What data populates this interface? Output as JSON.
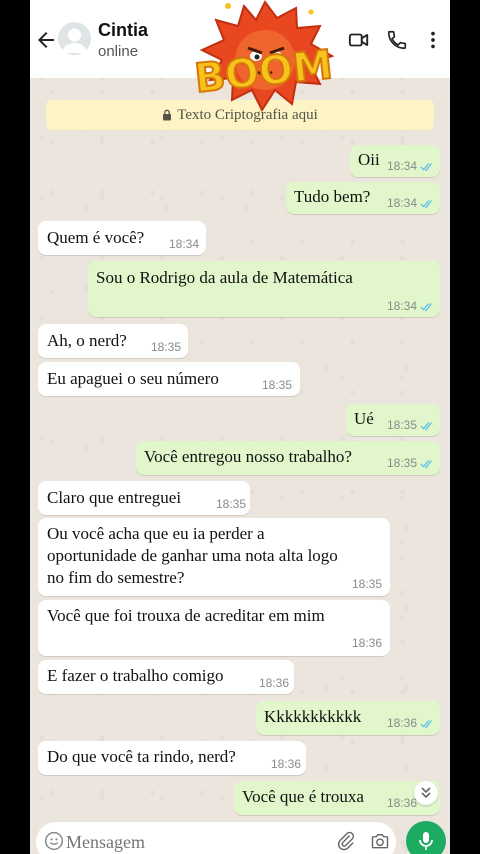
{
  "header": {
    "contact_name": "Cintia",
    "status": "online"
  },
  "sticker": {
    "text": "BOOM"
  },
  "banner": {
    "text": "Texto Criptografia aqui"
  },
  "messages": [
    {
      "dir": "out",
      "text": "Oii",
      "time": "18:34"
    },
    {
      "dir": "out",
      "text": "Tudo bem?",
      "time": "18:34"
    },
    {
      "dir": "in",
      "text": "Quem é você?",
      "time": "18:34"
    },
    {
      "dir": "out",
      "text": "Sou o Rodrigo da aula de Matemática",
      "time": "18:34"
    },
    {
      "dir": "in",
      "text": "Ah, o nerd?",
      "time": "18:35"
    },
    {
      "dir": "in",
      "text": "Eu apaguei o seu número",
      "time": "18:35"
    },
    {
      "dir": "out",
      "text": "Ué",
      "time": "18:35"
    },
    {
      "dir": "out",
      "text": "Você entregou nosso trabalho?",
      "time": "18:35"
    },
    {
      "dir": "in",
      "text": "Claro que entreguei",
      "time": "18:35"
    },
    {
      "dir": "in",
      "text": "Ou você acha que eu ia perder a\noportunidade de ganhar uma nota alta logo\nno fim do semestre?",
      "time": "18:35"
    },
    {
      "dir": "in",
      "text": "Você que foi trouxa de acreditar em mim",
      "time": "18:36"
    },
    {
      "dir": "in",
      "text": "E fazer o trabalho comigo",
      "time": "18:36"
    },
    {
      "dir": "out",
      "text": "Kkkkkkkkkkk",
      "time": "18:36"
    },
    {
      "dir": "in",
      "text": "Do que você ta rindo, nerd?",
      "time": "18:36"
    },
    {
      "dir": "out",
      "text": "Você que é trouxa",
      "time": "18:36"
    }
  ],
  "input": {
    "placeholder": "Mensagem"
  },
  "icons": {
    "back": "arrow-left-icon",
    "video": "video-camera-icon",
    "call": "phone-icon",
    "menu": "more-vert-icon",
    "emoji": "emoji-icon",
    "attach": "paperclip-icon",
    "camera": "camera-icon",
    "mic": "mic-icon"
  },
  "colors": {
    "outgoing_bubble": "#e1f7cb",
    "incoming_bubble": "#ffffff",
    "banner": "#fdf4c5",
    "read_tick": "#53bdeb",
    "mic_button": "#1daa61"
  }
}
